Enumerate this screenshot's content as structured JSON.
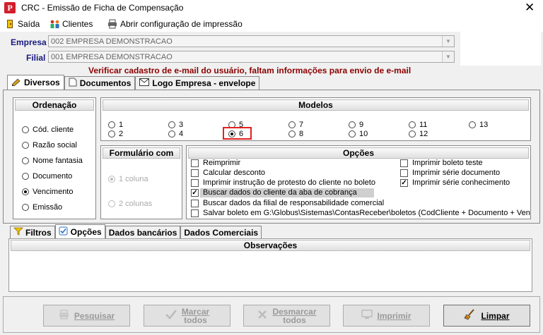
{
  "window": {
    "title": "CRC - Emissão de Ficha de Compensação",
    "close": "✕"
  },
  "menu": {
    "items": [
      {
        "label": "Saída"
      },
      {
        "label": "Clientes"
      },
      {
        "label": "Abrir configuração de impressão"
      }
    ]
  },
  "empresa": {
    "label": "Empresa",
    "value": "002 EMPRESA DEMONSTRACAO"
  },
  "filial": {
    "label": "Filial",
    "value": "001 EMPRESA DEMONSTRACAO"
  },
  "warning": "Verificar cadastro de e-mail do usuário, faltam informações para envio de e-mail",
  "top_tabs": [
    {
      "label": "Diversos",
      "icon": "pencil-icon"
    },
    {
      "label": "Documentos",
      "icon": "document-icon"
    },
    {
      "label": "Logo Empresa - envelope",
      "icon": "envelope-icon"
    }
  ],
  "ordenacao": {
    "title": "Ordenação",
    "options": [
      "Cód. cliente",
      "Razão social",
      "Nome fantasia",
      "Documento",
      "Vencimento",
      "Emissão"
    ],
    "selected": "Vencimento"
  },
  "modelos": {
    "title": "Modelos",
    "row1": [
      "1",
      "3",
      "5",
      "7",
      "9",
      "11",
      "13"
    ],
    "row2": [
      "2",
      "4",
      "6",
      "8",
      "10",
      "12"
    ],
    "selected": "6",
    "highlight_color": "#e02020"
  },
  "formulario": {
    "title": "Formulário com",
    "options": [
      "1 coluna",
      "2 colunas"
    ],
    "selected": "1 coluna"
  },
  "opcoes": {
    "title": "Opções",
    "left": [
      {
        "label": "Reimprimir",
        "checked": false
      },
      {
        "label": "Calcular desconto",
        "checked": false
      },
      {
        "label": "Imprimir instrução de protesto do cliente no boleto",
        "checked": false
      },
      {
        "label": "Buscar dados do cliente da aba de cobrança",
        "checked": true
      },
      {
        "label": "Buscar dados da filial de responsabilidade comercial",
        "checked": false
      },
      {
        "label": "Salvar boleto em G:\\Globus\\Sistemas\\ContasReceber\\boletos (CodCliente + Documento + Vencir",
        "checked": false
      }
    ],
    "right": [
      {
        "label": "Imprimir boleto teste",
        "checked": false
      },
      {
        "label": "Imprimir série documento",
        "checked": false
      },
      {
        "label": "Imprimir série conhecimento",
        "checked": true
      }
    ]
  },
  "bottom_tabs": [
    {
      "label": "Filtros",
      "icon": "funnel-icon"
    },
    {
      "label": "Opções",
      "icon": "checkbox-icon"
    },
    {
      "label": "Dados bancários"
    },
    {
      "label": "Dados Comerciais"
    }
  ],
  "observacoes": {
    "title": "Observações",
    "value": ""
  },
  "buttons": [
    {
      "label1": "Pesquisar",
      "label2": "",
      "enabled": false
    },
    {
      "label1": "Marcar",
      "label2": "todos",
      "enabled": false
    },
    {
      "label1": "Desmarcar",
      "label2": "todos",
      "enabled": false
    },
    {
      "label1": "Imprimir",
      "label2": "",
      "enabled": false
    },
    {
      "label1": "Limpar",
      "label2": "",
      "enabled": true
    }
  ]
}
